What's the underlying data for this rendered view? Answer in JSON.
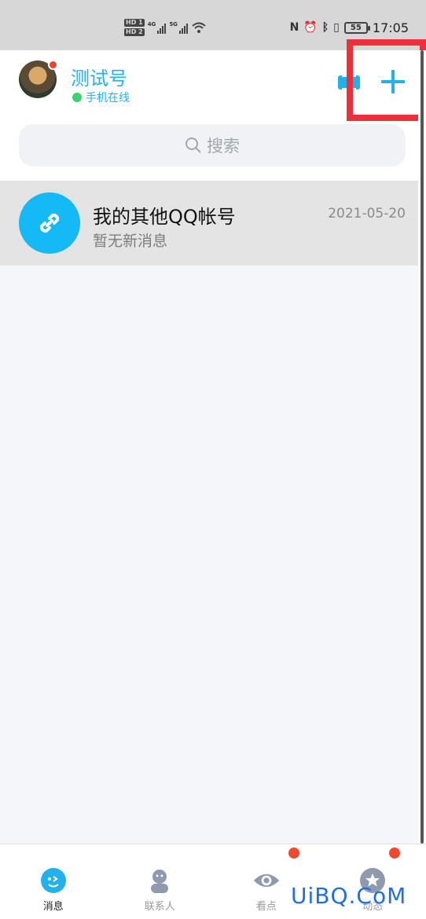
{
  "status_bar": {
    "hd1": "HD 1",
    "hd2": "HD 2",
    "net1": "4G",
    "net2": "5G",
    "battery": "55",
    "time": "17:05"
  },
  "header": {
    "nickname": "测试号",
    "presence": "手机在线"
  },
  "search": {
    "placeholder": "搜索"
  },
  "conversations": [
    {
      "title": "我的其他QQ帐号",
      "subtitle": "暂无新消息",
      "date": "2021-05-20"
    }
  ],
  "tabs": [
    {
      "label": "消息",
      "active": true
    },
    {
      "label": "联系人",
      "active": false
    },
    {
      "label": "看点",
      "active": false,
      "badge": true
    },
    {
      "label": "动态",
      "active": false,
      "badge": true
    }
  ],
  "colors": {
    "accent": "#22b1ea",
    "highlight": "#ec2f3b",
    "badge": "#f0472e"
  },
  "watermark": "UiBQ.CoM"
}
